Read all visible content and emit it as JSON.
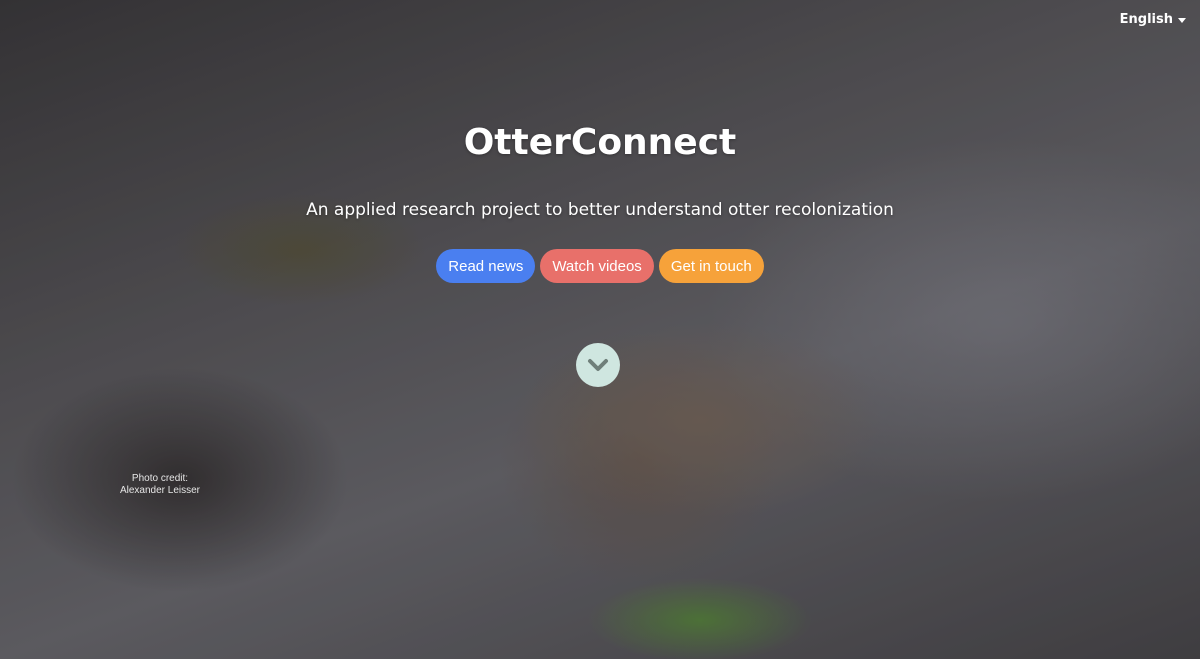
{
  "language": {
    "selected": "English"
  },
  "hero": {
    "title": "OtterConnect",
    "subtitle": "An applied research project to better understand otter recolonization"
  },
  "buttons": {
    "read_news": "Read news",
    "watch_videos": "Watch videos",
    "get_in_touch": "Get in touch"
  },
  "icons": {
    "scroll": "chevron-down-icon",
    "language": "caret-down-icon"
  },
  "photo_credit": {
    "line1": "Photo credit:",
    "line2": "Alexander Leisser"
  },
  "colors": {
    "read_news": "#4a7ff0",
    "watch_videos": "#e8706a",
    "get_in_touch": "#f6a23a",
    "scroll_button": "#cfe6e0"
  }
}
